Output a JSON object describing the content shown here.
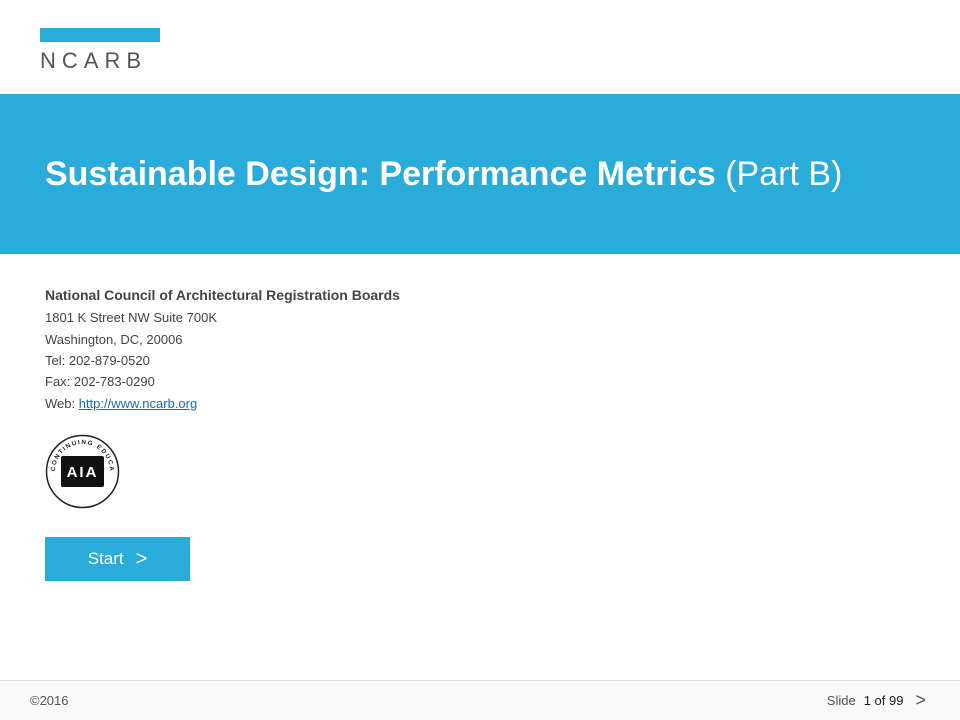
{
  "header": {
    "logo_text": "NCARB"
  },
  "banner": {
    "title_bold": "Sustainable Design: Performance Metrics",
    "title_normal": " (Part B)"
  },
  "content": {
    "org_name": "National Council of Architectural Registration Boards",
    "address_line1": "1801 K Street NW Suite 700K",
    "address_line2": "Washington, DC, 20006",
    "tel": "Tel:  202-879-0520",
    "fax": "Fax:  202-783-0290",
    "web_label": "Web: ",
    "web_url": "http://www.ncarb.org",
    "aia_label": "AIA",
    "aia_arc_top": "CONTINUING EDUCATION",
    "start_label": "Start",
    "start_arrow": ">"
  },
  "footer": {
    "copyright": "©2016",
    "slide_label": "Slide",
    "slide_count": "1 of 99",
    "next_arrow": ">"
  },
  "colors": {
    "accent": "#29acd9",
    "text_dark": "#444444",
    "link": "#1a6bb5"
  }
}
